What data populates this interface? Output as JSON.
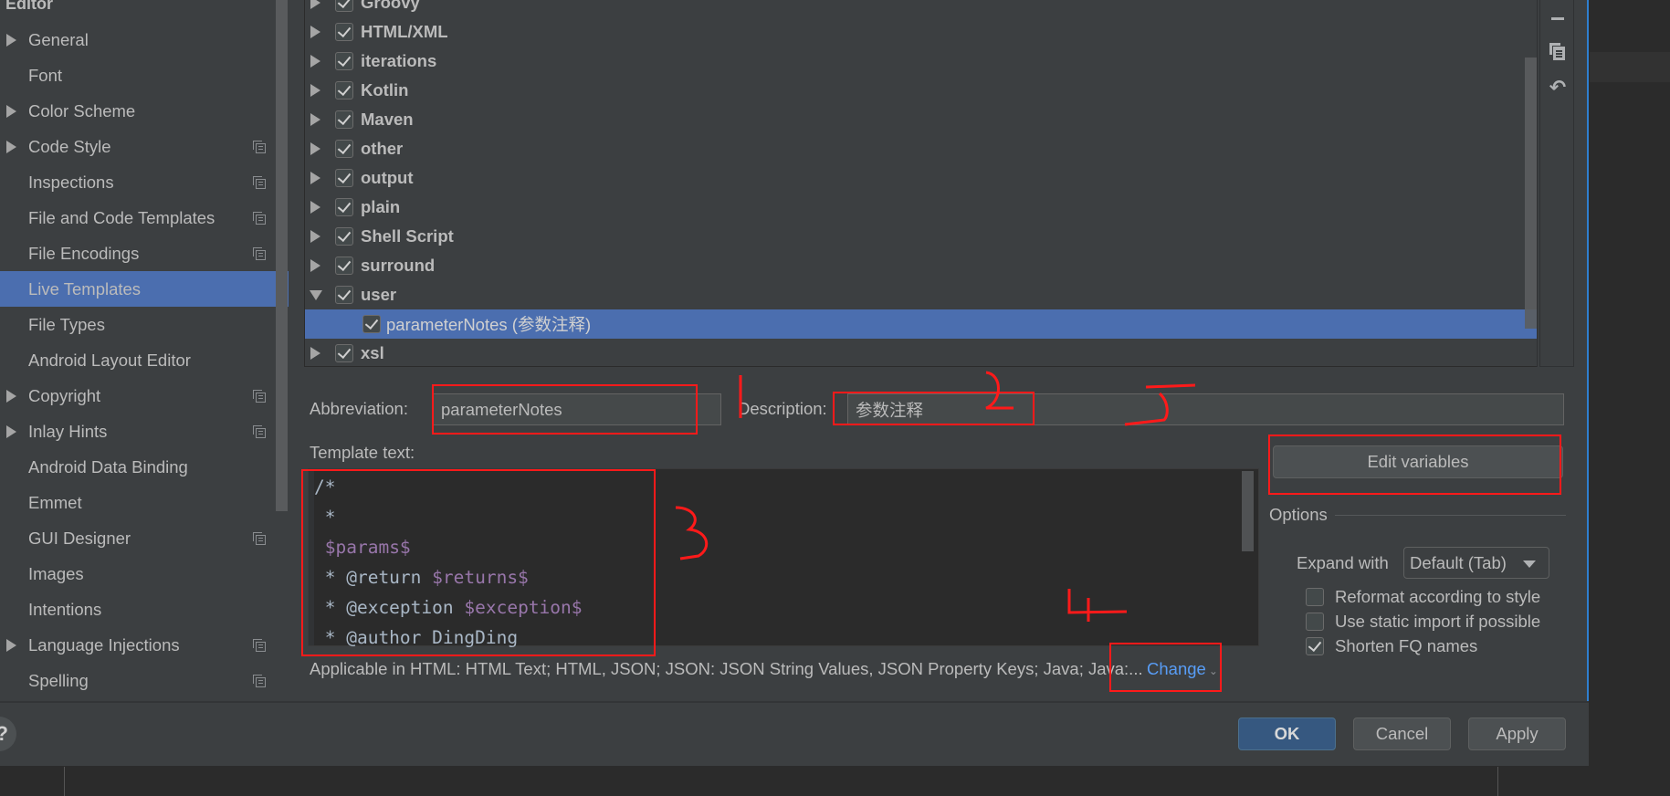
{
  "sidebar": {
    "group_title": "Editor",
    "items": [
      {
        "label": "General",
        "expandable": true,
        "project_scope": false,
        "selected": false
      },
      {
        "label": "Font",
        "expandable": false,
        "project_scope": false,
        "selected": false
      },
      {
        "label": "Color Scheme",
        "expandable": true,
        "project_scope": false,
        "selected": false
      },
      {
        "label": "Code Style",
        "expandable": true,
        "project_scope": true,
        "selected": false
      },
      {
        "label": "Inspections",
        "expandable": false,
        "project_scope": true,
        "selected": false
      },
      {
        "label": "File and Code Templates",
        "expandable": false,
        "project_scope": true,
        "selected": false
      },
      {
        "label": "File Encodings",
        "expandable": false,
        "project_scope": true,
        "selected": false
      },
      {
        "label": "Live Templates",
        "expandable": false,
        "project_scope": false,
        "selected": true
      },
      {
        "label": "File Types",
        "expandable": false,
        "project_scope": false,
        "selected": false
      },
      {
        "label": "Android Layout Editor",
        "expandable": false,
        "project_scope": false,
        "selected": false
      },
      {
        "label": "Copyright",
        "expandable": true,
        "project_scope": true,
        "selected": false
      },
      {
        "label": "Inlay Hints",
        "expandable": true,
        "project_scope": true,
        "selected": false
      },
      {
        "label": "Android Data Binding",
        "expandable": false,
        "project_scope": false,
        "selected": false
      },
      {
        "label": "Emmet",
        "expandable": false,
        "project_scope": false,
        "selected": false
      },
      {
        "label": "GUI Designer",
        "expandable": false,
        "project_scope": true,
        "selected": false
      },
      {
        "label": "Images",
        "expandable": false,
        "project_scope": false,
        "selected": false
      },
      {
        "label": "Intentions",
        "expandable": false,
        "project_scope": false,
        "selected": false
      },
      {
        "label": "Language Injections",
        "expandable": true,
        "project_scope": true,
        "selected": false
      },
      {
        "label": "Spelling",
        "expandable": false,
        "project_scope": true,
        "selected": false
      }
    ]
  },
  "template_tree": {
    "groups": [
      {
        "label": "Groovy",
        "checked": true,
        "expanded": false
      },
      {
        "label": "HTML/XML",
        "checked": true,
        "expanded": false
      },
      {
        "label": "iterations",
        "checked": true,
        "expanded": false
      },
      {
        "label": "Kotlin",
        "checked": true,
        "expanded": false
      },
      {
        "label": "Maven",
        "checked": true,
        "expanded": false
      },
      {
        "label": "other",
        "checked": true,
        "expanded": false
      },
      {
        "label": "output",
        "checked": true,
        "expanded": false
      },
      {
        "label": "plain",
        "checked": true,
        "expanded": false
      },
      {
        "label": "Shell Script",
        "checked": true,
        "expanded": false
      },
      {
        "label": "surround",
        "checked": true,
        "expanded": false
      },
      {
        "label": "user",
        "checked": true,
        "expanded": true
      },
      {
        "label": "parameterNotes (参数注释)",
        "checked": true,
        "child": true,
        "selected": true
      },
      {
        "label": "xsl",
        "checked": true,
        "expanded": false
      }
    ],
    "toolbar": [
      "remove-icon",
      "copy-icon",
      "restore-defaults-icon"
    ]
  },
  "form": {
    "abbreviation_label": "Abbreviation:",
    "abbreviation_value": "parameterNotes",
    "description_label": "Description:",
    "description_value": "参数注释",
    "template_text_label": "Template text:",
    "template_lines": [
      [
        {
          "t": "/*",
          "v": false
        }
      ],
      [
        {
          "t": " *",
          "v": false
        }
      ],
      [
        {
          "t": " ",
          "v": false
        },
        {
          "t": "$params$",
          "v": true
        }
      ],
      [
        {
          "t": " * @return ",
          "v": false
        },
        {
          "t": "$returns$",
          "v": true
        }
      ],
      [
        {
          "t": " * @exception ",
          "v": false
        },
        {
          "t": "$exception$",
          "v": true
        }
      ],
      [
        {
          "t": " * @author DingDing",
          "v": false
        }
      ]
    ],
    "edit_variables_label": "Edit variables",
    "applicable_text": "Applicable in HTML: HTML Text; HTML, JSON; JSON: JSON String Values, JSON Property Keys; Java; Java:...",
    "change_label": "Change"
  },
  "options": {
    "title": "Options",
    "expand_with_label": "Expand with",
    "expand_with_value": "Default (Tab)",
    "checkboxes": [
      {
        "label": "Reformat according to style",
        "checked": false
      },
      {
        "label": "Use static import if possible",
        "checked": false
      },
      {
        "label": "Shorten FQ names",
        "checked": true
      }
    ]
  },
  "buttons": {
    "help": "?",
    "ok": "OK",
    "cancel": "Cancel",
    "apply": "Apply"
  },
  "annotations": {
    "color": "#ff1a1a",
    "numbers": [
      "1",
      "2",
      "3",
      "4"
    ]
  }
}
